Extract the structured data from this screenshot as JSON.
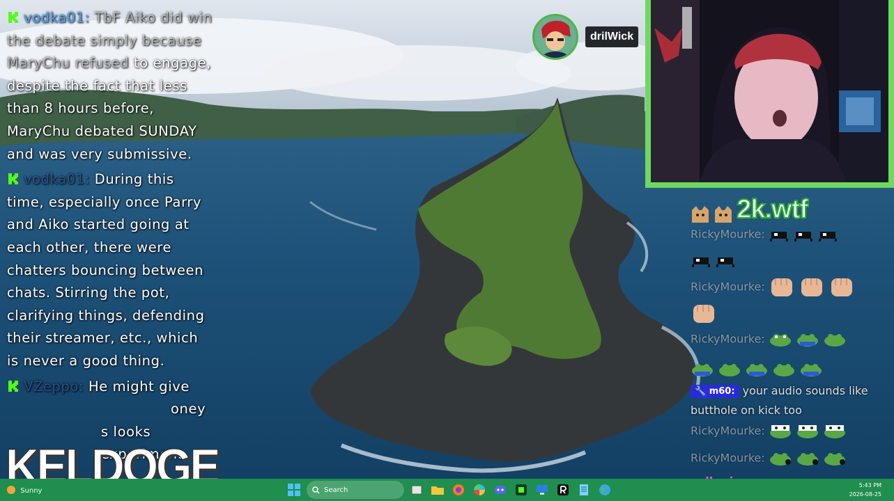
{
  "left_chat": {
    "messages": [
      {
        "user": "vodka01:",
        "text_faded": "TbF Aiko did win the debate simply because MaryChu refused",
        "text": "to engage, despite the fact that less than 8 hours before, MaryChu debated SUNDAY and was very submissive."
      },
      {
        "user": "vodka01:",
        "text": "During this time, especially once Parry and Aiko started going at each other, there were chatters bouncing between chats. Stirring the pot, clarifying things, defending their streamer, etc., which is never a good thing."
      },
      {
        "user": "VZeppo:",
        "text": "He might give",
        "text_cont": "oney",
        "text_cont2": "s looks experiment"
      }
    ]
  },
  "logo": {
    "text": "KELDOGE"
  },
  "user_badge": {
    "name": "drilWick"
  },
  "right_chat": {
    "twok_text": "2k.wtf",
    "lines": [
      {
        "user": "RickyMourke:"
      },
      {
        "user": "RickyMourke:"
      },
      {
        "user": "RickyMourke:"
      },
      {
        "mod_badge": "m60:",
        "text": "your audio sounds like",
        "text2": "butthole on kick too"
      },
      {
        "user": "RickyMourke:"
      },
      {
        "user": "RickyMourke:"
      },
      {
        "user": "valkyrie:"
      }
    ]
  },
  "taskbar": {
    "weather": "Sunny",
    "search_label": "Search",
    "time": "5:43 PM",
    "date": "2026-08-25"
  },
  "colors": {
    "chat_user": "#4aa3ff",
    "webcam_border": "#6fd860",
    "taskbar": "#1f8e4e",
    "kick_green": "#53fc18"
  }
}
